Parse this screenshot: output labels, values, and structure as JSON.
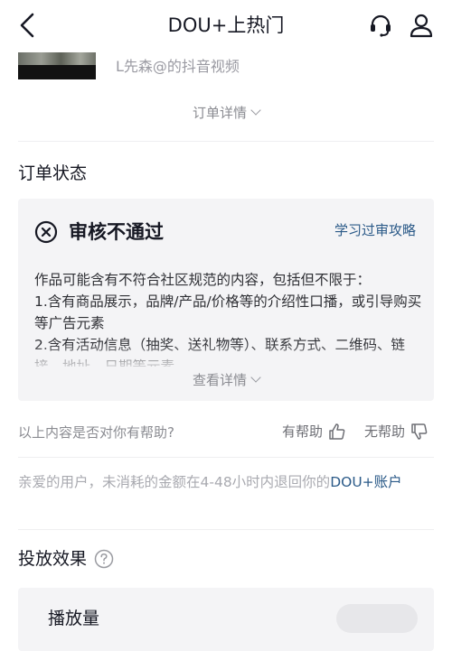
{
  "header": {
    "title": "DOU+上热门",
    "back_icon": "chevron-left-icon",
    "service_icon": "headset-icon",
    "user_icon": "user-icon"
  },
  "video": {
    "author": "L先森@的抖音视频"
  },
  "order_detail_link": "订单详情",
  "order_status": {
    "heading": "订单状态",
    "status_title": "审核不通过",
    "status_icon": "close-circle-icon",
    "guide_link": "学习过审攻略",
    "paragraphs": [
      "作品可能含有不符合社区规范的内容，包括但不限于：",
      " 1.含有商品展示，品牌/产品/价格等的介绍性口播，或引导购买等广告元素",
      " 2.含有活动信息（抽奖、送礼物等）、联系方式、二维码、链接、地址、日期等元素"
    ],
    "view_detail": "查看详情"
  },
  "feedback": {
    "question": "以上内容是否对你有帮助?",
    "yes_label": "有帮助",
    "no_label": "无帮助",
    "yes_icon": "thumbs-up-icon",
    "no_icon": "thumbs-down-icon"
  },
  "refund_note": {
    "text": "亲爱的用户，未消耗的金额在4-48小时内退回你的",
    "link": "DOU+账户"
  },
  "effect": {
    "heading": "投放效果",
    "help_icon": "question-circle-icon",
    "play_label": "播放量"
  },
  "colors": {
    "link": "#2b5a88",
    "card_bg": "#f4f4f6",
    "muted_text": "#8a8b91"
  }
}
